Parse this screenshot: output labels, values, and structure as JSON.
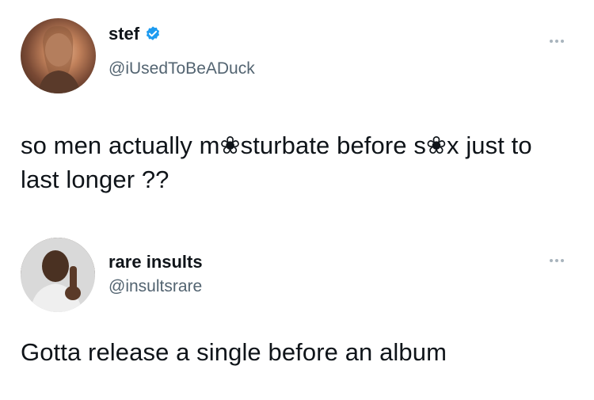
{
  "tweets": [
    {
      "display_name": "stef",
      "handle": "@iUsedToBeADuck",
      "verified": true,
      "text": "so men actually m❀sturbate before s❀x just to last longer ??"
    },
    {
      "display_name": "rare insults",
      "handle": "@insultsrare",
      "verified": false,
      "text": "Gotta release a single before an album"
    }
  ],
  "colors": {
    "verified_badge": "#1d9bf0",
    "handle_text": "#536471",
    "more_dots": "#a8b4bd"
  },
  "icons": {
    "verified": "verified-badge-icon",
    "more": "more-options-icon"
  }
}
